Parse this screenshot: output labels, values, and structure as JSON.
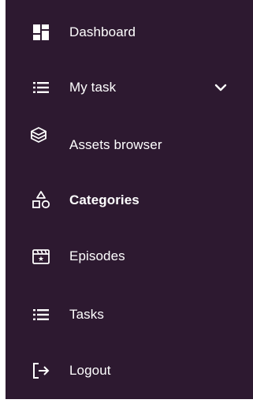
{
  "sidebar": {
    "background": "#2d1930",
    "items": [
      {
        "label": "Dashboard",
        "icon": "dashboard-icon"
      },
      {
        "label": "My task",
        "icon": "list-icon",
        "expandable": true
      },
      {
        "label": "Assets browser",
        "icon": "cube-icon"
      },
      {
        "label": "Categories",
        "icon": "categories-icon",
        "active": true
      },
      {
        "label": "Episodes",
        "icon": "clapperboard-icon"
      },
      {
        "label": "Tasks",
        "icon": "list-icon"
      },
      {
        "label": "Logout",
        "icon": "logout-icon"
      }
    ]
  }
}
